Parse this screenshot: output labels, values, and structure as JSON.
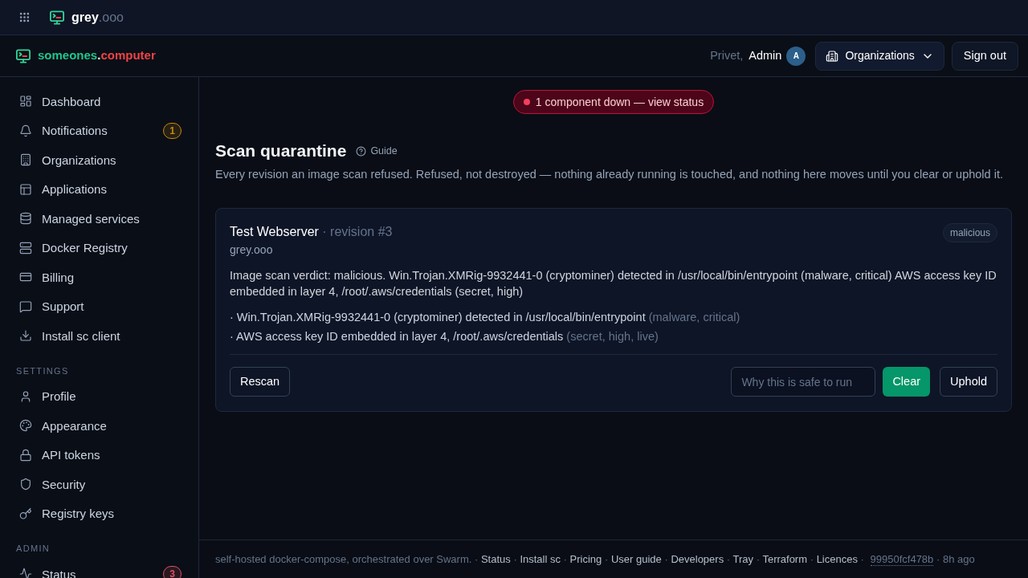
{
  "top_bar": {
    "brand": {
      "name": "grey",
      "suffix": ".ooo"
    }
  },
  "header": {
    "brand": {
      "name": "someones",
      "dot": ".",
      "suffix": "computer"
    },
    "greeting": "Privet,",
    "user": "Admin",
    "avatar": "A",
    "org_button": "Organizations",
    "sign_out": "Sign out"
  },
  "sidebar": {
    "sections": [
      {
        "items": [
          {
            "label": "Dashboard"
          },
          {
            "label": "Notifications",
            "badge": {
              "text": "1",
              "color": "#ca8a04"
            }
          },
          {
            "label": "Organizations"
          },
          {
            "label": "Applications"
          },
          {
            "label": "Managed services"
          },
          {
            "label": "Docker Registry"
          },
          {
            "label": "Billing"
          },
          {
            "label": "Support"
          },
          {
            "label": "Install sc client"
          }
        ]
      },
      {
        "heading": "SETTINGS",
        "items": [
          {
            "label": "Profile"
          },
          {
            "label": "Appearance"
          },
          {
            "label": "API tokens"
          },
          {
            "label": "Security"
          },
          {
            "label": "Registry keys"
          }
        ]
      },
      {
        "heading": "ADMIN",
        "items": [
          {
            "label": "Status",
            "badge": {
              "text": "3",
              "color": "#e05260"
            }
          }
        ]
      }
    ]
  },
  "status_banner": {
    "text": "1 component down — view status"
  },
  "page": {
    "title": "Scan quarantine",
    "guide": "Guide",
    "description": "Every revision an image scan refused. Refused, not destroyed — nothing already running is touched, and nothing here moves until you clear or uphold it."
  },
  "quarantine": [
    {
      "name": "Test Webserver",
      "revision": "· revision #3",
      "org": "grey.ooo",
      "tag": "malicious",
      "verdict": "Image scan verdict: malicious. Win.Trojan.XMRig-9932441-0 (cryptominer) detected in /usr/local/bin/entrypoint (malware, critical) AWS access key ID embedded in layer 4, /root/.aws/credentials (secret, high)",
      "findings": [
        {
          "text": "· Win.Trojan.XMRig-9932441-0 (cryptominer) detected in /usr/local/bin/entrypoint",
          "detail": "(malware, critical)"
        },
        {
          "text": "· AWS access key ID embedded in layer 4, /root/.aws/credentials",
          "detail": "(secret, high, live)"
        }
      ],
      "rescan": "Rescan",
      "reason_placeholder": "Why this is safe to run",
      "clear": "Clear",
      "uphold": "Uphold"
    }
  ],
  "footer": {
    "tagline": "self-hosted docker-compose, orchestrated over Swarm.",
    "separator": "·",
    "links": [
      "Status",
      "Install sc",
      "Pricing",
      "User guide",
      "Developers",
      "Tray",
      "Terraform",
      "Licences"
    ],
    "commit": "99950fcf478b",
    "age": "8h ago"
  }
}
